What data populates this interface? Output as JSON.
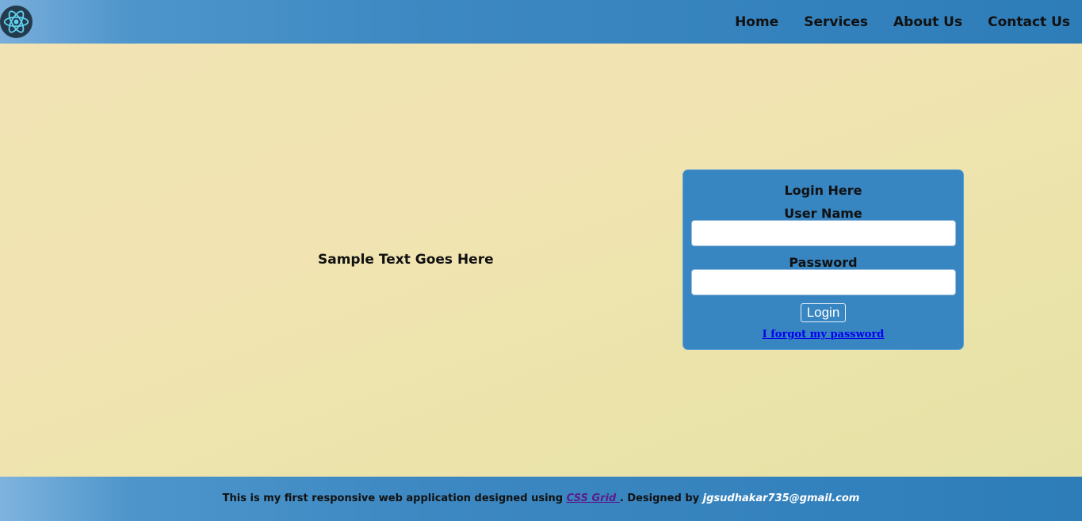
{
  "header": {
    "logo_icon": "react-atom-icon",
    "nav": [
      {
        "label": "Home"
      },
      {
        "label": "Services"
      },
      {
        "label": "About Us"
      },
      {
        "label": "Contact Us"
      }
    ]
  },
  "main": {
    "sample_text": "Sample Text Goes Here"
  },
  "login": {
    "title": "Login Here",
    "username_label": "User Name",
    "username_value": "",
    "password_label": "Password",
    "password_value": "",
    "button_label": "Login",
    "forgot_link": "I forgot my password"
  },
  "footer": {
    "prefix": "This is my first responsive web application designed using ",
    "link": "CSS Grid ",
    "middle": ". Designed by ",
    "email": "jgsudhakar735@gmail.com"
  },
  "colors": {
    "header_bg": "#2d7db9",
    "login_bg": "#3785c1",
    "page_bg": "#f1e4b2",
    "link": "#0000ee",
    "visited_link": "#5a1d8a"
  }
}
